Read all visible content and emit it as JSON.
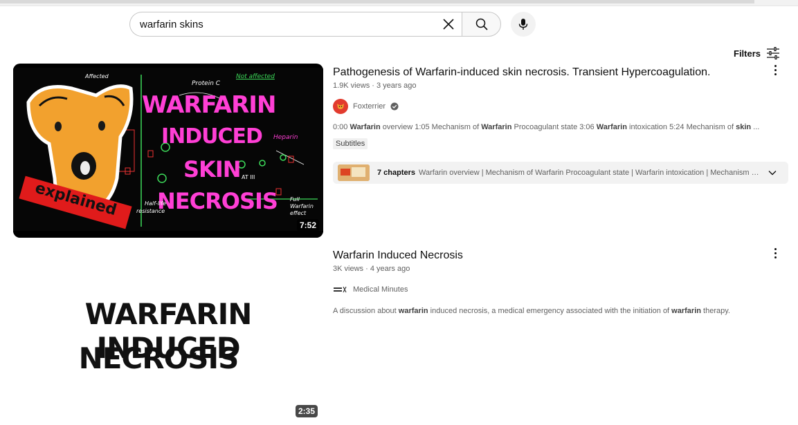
{
  "search": {
    "query": "warfarin skins"
  },
  "filters": {
    "label": "Filters"
  },
  "results": [
    {
      "title": "Pathogenesis of Warfarin-induced skin necrosis. Transient Hypercoagulation.",
      "views": "1.9K views",
      "age": "3 years ago",
      "channel": "Foxterrier",
      "verified": true,
      "description_parts": [
        {
          "t": "0:00 ",
          "b": false
        },
        {
          "t": "Warfarin",
          "b": true
        },
        {
          "t": " overview 1:05 Mechanism of ",
          "b": false
        },
        {
          "t": "Warfarin",
          "b": true
        },
        {
          "t": " Procoagulant state 3:06 ",
          "b": false
        },
        {
          "t": "Warfarin",
          "b": true
        },
        {
          "t": " intoxication 5:24 Mechanism of ",
          "b": false
        },
        {
          "t": "skin",
          "b": true
        },
        {
          "t": " ...",
          "b": false
        }
      ],
      "badge": "Subtitles",
      "duration": "7:52",
      "chapters": {
        "count": "7 chapters",
        "list": "Warfarin overview | Mechanism of Warfarin Procoagulant state | Warfarin intoxication | Mechanism of skin necrosis"
      },
      "thumbnail_text": {
        "line1": "WARFARIN",
        "line2": "INDUCED",
        "line3": "SKIN",
        "line4": "NECROSIS",
        "ribbon": "explained",
        "note1": "Not affected",
        "note2": "Protein C",
        "note3": "Heparin",
        "note4": "Full Warfarin effect",
        "note5": "Half-life",
        "note6": "resistance",
        "note7": "Affected",
        "note8": "AT III"
      }
    },
    {
      "title": "Warfarin Induced Necrosis",
      "views": "3K views",
      "age": "4 years ago",
      "channel": "Medical Minutes",
      "verified": false,
      "description_parts": [
        {
          "t": "A discussion about ",
          "b": false
        },
        {
          "t": "warfarin",
          "b": true
        },
        {
          "t": " induced necrosis, a medical emergency associated with the initiation of ",
          "b": false
        },
        {
          "t": "warfarin",
          "b": true
        },
        {
          "t": " therapy.",
          "b": false
        }
      ],
      "duration": "2:35",
      "thumbnail_text": {
        "line1": "WARFARIN INDUCED",
        "line2": "NECROSIS"
      }
    }
  ],
  "colors": {
    "pink": "#ff3fd5",
    "red_ribbon": "#e01b1b",
    "dog": "#f2a12e",
    "avatar_red": "#e23b2e"
  }
}
